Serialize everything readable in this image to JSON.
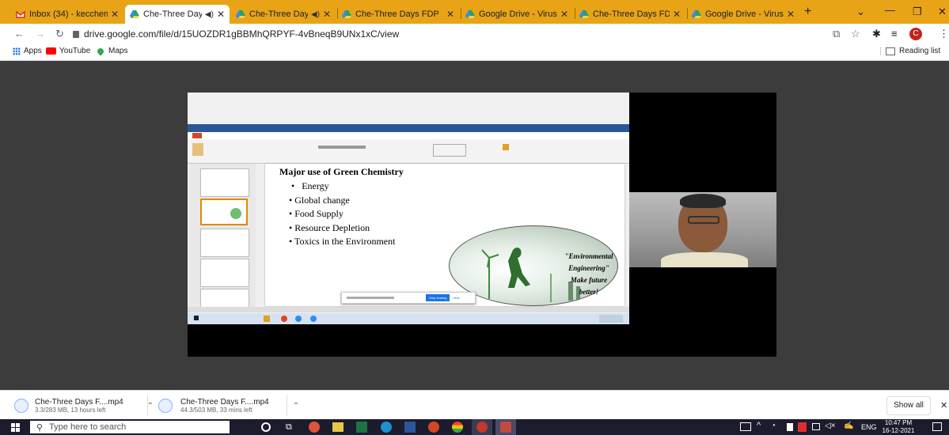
{
  "tabs": [
    {
      "label": "Inbox (34) - kecchem",
      "icon": "gmail-icon"
    },
    {
      "label": "Che-Three Days",
      "icon": "drive-icon",
      "active": true
    },
    {
      "label": "Che-Three Days F",
      "icon": "drive-icon"
    },
    {
      "label": "Che-Three Days FDP",
      "icon": "drive-icon"
    },
    {
      "label": "Google Drive - Virus",
      "icon": "drive-icon"
    },
    {
      "label": "Che-Three Days FDP",
      "icon": "drive-icon"
    },
    {
      "label": "Google Drive - Virus",
      "icon": "drive-icon"
    }
  ],
  "toolbar": {
    "url": "drive.google.com/file/d/15UOZDR1gBBMhQRPYF-4vBneqB9UNx1xC/view"
  },
  "bookmarks": {
    "apps": "Apps",
    "youtube": "YouTube",
    "maps": "Maps",
    "reading_list": "Reading list"
  },
  "slide": {
    "title": "Major use of Green Chemistry",
    "bullets": [
      "Energy",
      "Global change",
      "Food Supply",
      "Resource Depletion",
      "Toxics in the Environment"
    ],
    "quote": [
      "\"Environmental",
      "Engineering\"",
      "Make future",
      "better!"
    ],
    "stop_sharing": "Stop sharing",
    "hide": "Hide"
  },
  "downloads": [
    {
      "name": "Che-Three Days F....mp4",
      "status": "3.3/283 MB, 13 hours left"
    },
    {
      "name": "Che-Three Days F....mp4",
      "status": "44.3/503 MB, 33 mins left"
    }
  ],
  "download_bar": {
    "show_all": "Show all"
  },
  "taskbar": {
    "search": "Type here to search",
    "lang": "ENG",
    "time": "10:47 PM",
    "date": "16-12-2021"
  }
}
